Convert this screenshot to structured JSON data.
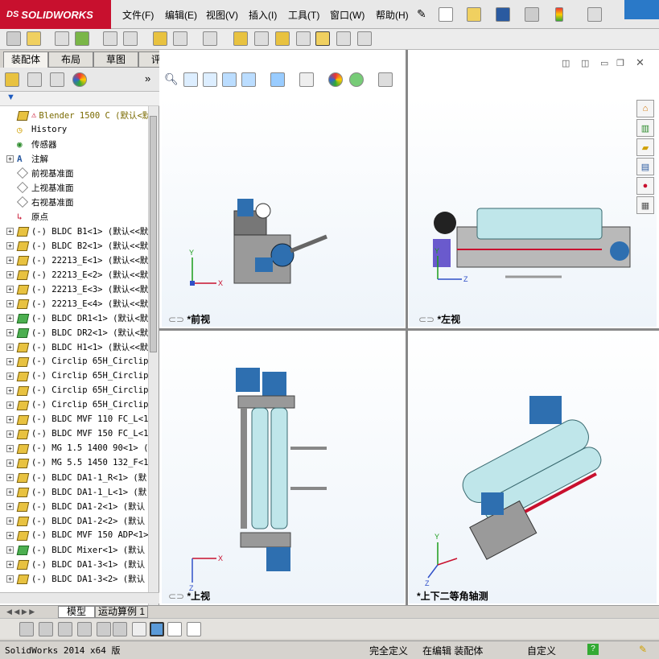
{
  "app": {
    "logo_text": "SOLIDWORKS",
    "logo_prefix": "DS"
  },
  "menu": [
    "文件(F)",
    "编辑(E)",
    "视图(V)",
    "插入(I)",
    "工具(T)",
    "窗口(W)",
    "帮助(H)"
  ],
  "command_tabs": [
    "装配体",
    "布局",
    "草图",
    "评估"
  ],
  "feature_tree": {
    "root": "Blender 1500 C  (默认<默",
    "items": [
      {
        "label": "History",
        "kind": "history"
      },
      {
        "label": "传感器",
        "kind": "sensor"
      },
      {
        "label": "注解",
        "kind": "annotation",
        "expand": true
      },
      {
        "label": "前视基准面",
        "kind": "plane"
      },
      {
        "label": "上视基准面",
        "kind": "plane"
      },
      {
        "label": "右视基准面",
        "kind": "plane"
      },
      {
        "label": "原点",
        "kind": "origin"
      },
      {
        "label": "(-) BLDC B1<1> (默认<<默",
        "kind": "part"
      },
      {
        "label": "(-) BLDC B2<1> (默认<<默",
        "kind": "part"
      },
      {
        "label": "(-) 22213_E<1> (默认<<默",
        "kind": "part"
      },
      {
        "label": "(-) 22213_E<2> (默认<<默",
        "kind": "part"
      },
      {
        "label": "(-) 22213_E<3> (默认<<默",
        "kind": "part"
      },
      {
        "label": "(-) 22213_E<4> (默认<<默",
        "kind": "part"
      },
      {
        "label": "(-) BLDC DR1<1> (默认<默",
        "kind": "part-green"
      },
      {
        "label": "(-) BLDC DR2<1> (默认<默",
        "kind": "part-green"
      },
      {
        "label": "(-) BLDC H1<1> (默认<<默",
        "kind": "part"
      },
      {
        "label": "(-) Circlip 65H_Circlip",
        "kind": "part"
      },
      {
        "label": "(-) Circlip 65H_Circlip",
        "kind": "part"
      },
      {
        "label": "(-) Circlip 65H_Circlip",
        "kind": "part"
      },
      {
        "label": "(-) Circlip 65H_Circlip",
        "kind": "part"
      },
      {
        "label": "(-) BLDC MVF 110 FC_L<1",
        "kind": "part"
      },
      {
        "label": "(-) BLDC MVF 150 FC_L<1",
        "kind": "part"
      },
      {
        "label": "(-) MG 1.5 1400 90<1> (",
        "kind": "part"
      },
      {
        "label": "(-) MG 5.5 1450 132_F<1",
        "kind": "part"
      },
      {
        "label": "(-) BLDC DA1-1_R<1> (默",
        "kind": "part"
      },
      {
        "label": "(-) BLDC DA1-1_L<1> (默",
        "kind": "part"
      },
      {
        "label": "(-) BLDC DA1-2<1> (默认",
        "kind": "part"
      },
      {
        "label": "(-) BLDC DA1-2<2> (默认",
        "kind": "part"
      },
      {
        "label": "(-) BLDC MVF 150 ADP<1>",
        "kind": "part"
      },
      {
        "label": "(-) BLDC Mixer<1> (默认",
        "kind": "part-green"
      },
      {
        "label": "(-) BLDC DA1-3<1> (默认",
        "kind": "part"
      },
      {
        "label": "(-) BLDC DA1-3<2> (默认",
        "kind": "part"
      }
    ]
  },
  "viewports": [
    {
      "label": "*前视"
    },
    {
      "label": "*左视"
    },
    {
      "label": "*上视"
    },
    {
      "label": "*上下二等角轴测"
    }
  ],
  "bottom_tabs": [
    "模型",
    "运动算例 1"
  ],
  "status": {
    "version": "SolidWorks 2014 x64 版",
    "definition": "完全定义",
    "editing": "在编辑 装配体",
    "custom": "自定义"
  },
  "colors": {
    "brand": "#c8102e",
    "roller": "#bfe6ea",
    "frame": "#9a9a9a",
    "motor": "#2e6fb0"
  }
}
